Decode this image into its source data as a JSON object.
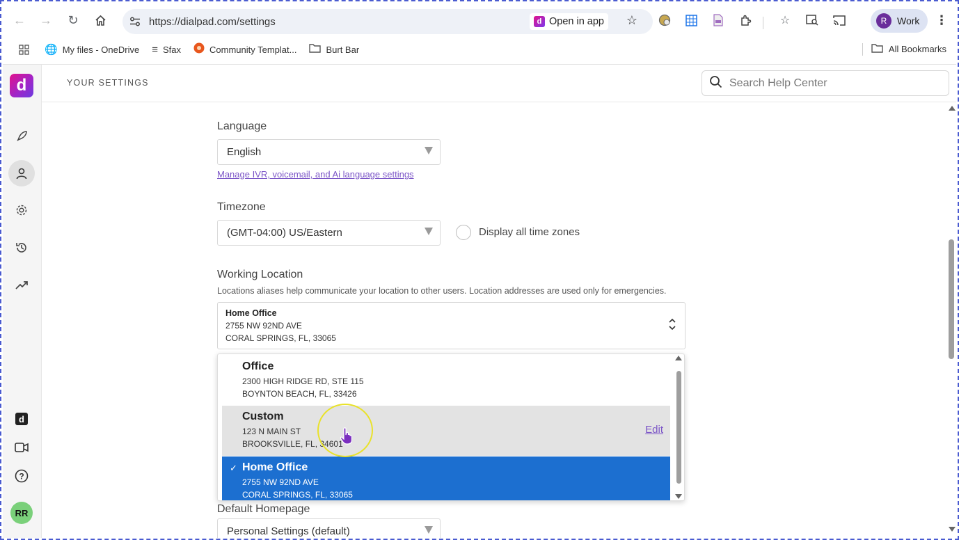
{
  "browser": {
    "url": "https://dialpad.com/settings",
    "open_in_app": "Open in app",
    "profile_initial": "R",
    "profile_label": "Work"
  },
  "bookmarks": {
    "items": [
      {
        "label": "My files - OneDrive",
        "icon": "globe-icon"
      },
      {
        "label": "Sfax",
        "icon": "sfax-icon"
      },
      {
        "label": "Community Templat...",
        "icon": "community-icon"
      },
      {
        "label": "Burt Bar",
        "icon": "folder-icon"
      }
    ],
    "all_bookmarks": "All Bookmarks"
  },
  "app": {
    "logo_letter": "d",
    "header_title": "YOUR SETTINGS",
    "search_placeholder": "Search Help Center",
    "user_initials": "RR"
  },
  "settings": {
    "language": {
      "label": "Language",
      "value": "English",
      "link": "Manage IVR, voicemail, and Ai language settings"
    },
    "timezone": {
      "label": "Timezone",
      "value": "(GMT-04:00) US/Eastern",
      "display_all": "Display all time zones"
    },
    "working_location": {
      "label": "Working Location",
      "help": "Locations aliases help communicate your location to other users. Location addresses are used only for emergencies.",
      "selected": {
        "name": "Home Office",
        "line1": "2755 NW 92ND AVE",
        "line2": "CORAL SPRINGS, FL, 33065"
      },
      "options": [
        {
          "name": "Office",
          "line1": "2300 HIGH RIDGE RD, STE 115",
          "line2": "BOYNTON BEACH, FL, 33426"
        },
        {
          "name": "Custom",
          "line1": "123 N MAIN ST",
          "line2": "BROOKSVILLE, FL, 34601",
          "edit": "Edit"
        },
        {
          "name": "Home Office",
          "line1": "2755 NW 92ND AVE",
          "line2": "CORAL SPRINGS, FL, 33065"
        }
      ]
    },
    "default_homepage": {
      "label": "Default Homepage",
      "value": "Personal Settings (default)"
    }
  }
}
